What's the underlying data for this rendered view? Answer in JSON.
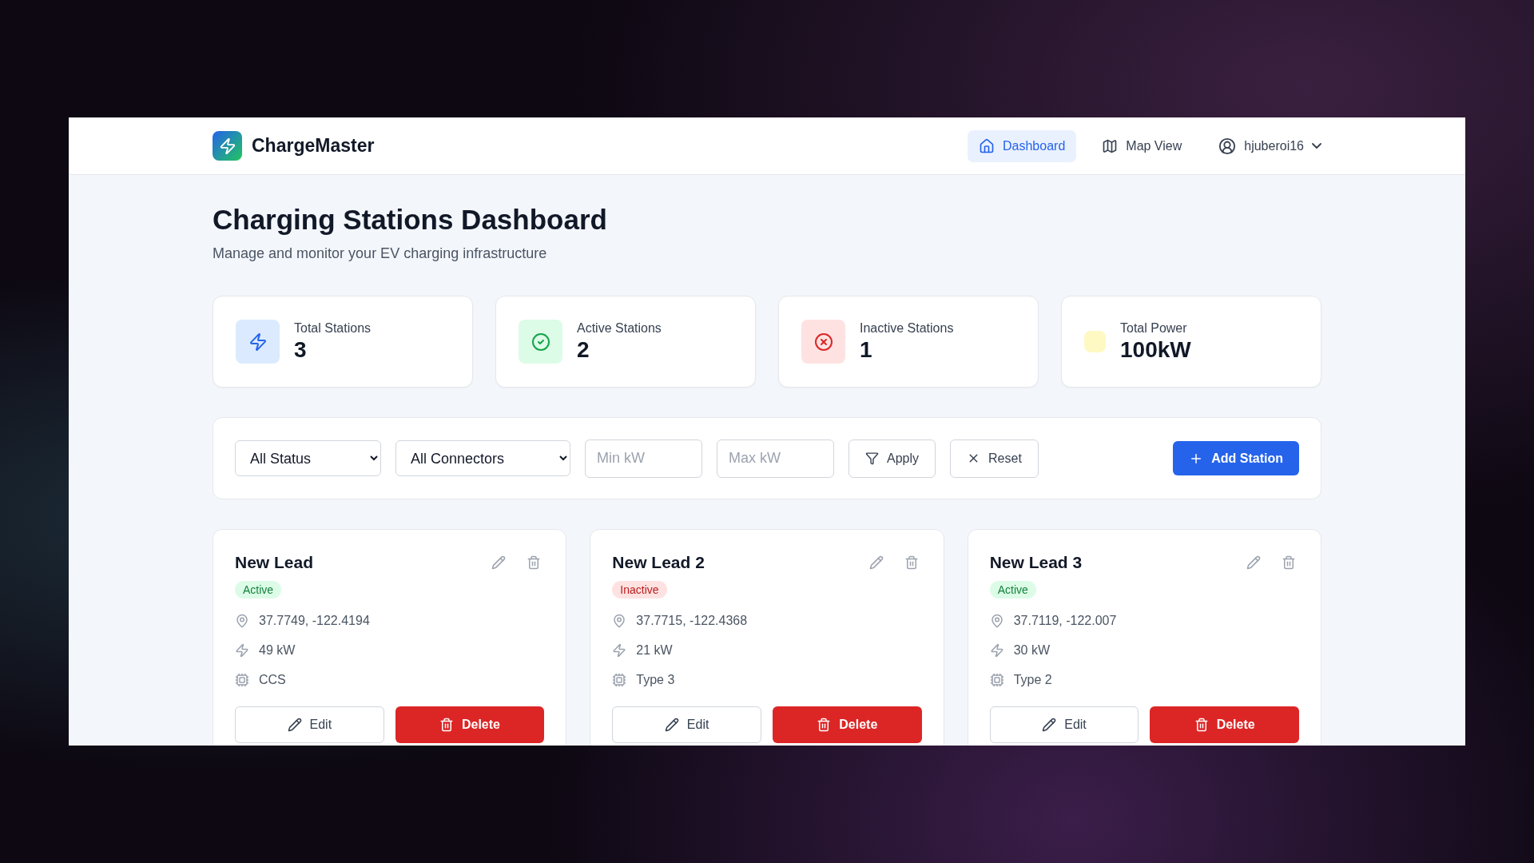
{
  "header": {
    "brand": "ChargeMaster",
    "nav": [
      {
        "label": "Dashboard",
        "kind": "home",
        "selected": true
      },
      {
        "label": "Map View",
        "kind": "map",
        "selected": false
      }
    ],
    "user": "hjuberoi16"
  },
  "page": {
    "title": "Charging Stations Dashboard",
    "subtitle": "Manage and monitor your EV charging infrastructure"
  },
  "stats": [
    {
      "label": "Total Stations",
      "value": "3",
      "kind": "bolt"
    },
    {
      "label": "Active Stations",
      "value": "2",
      "kind": "check"
    },
    {
      "label": "Inactive Stations",
      "value": "1",
      "kind": "cross"
    },
    {
      "label": "Total Power",
      "value": "100kW",
      "kind": "power"
    }
  ],
  "filters": {
    "status": "All Status",
    "connector": "All Connectors",
    "min_placeholder": "Min kW",
    "max_placeholder": "Max kW",
    "apply": "Apply",
    "reset": "Reset",
    "add": "Add Station"
  },
  "stations": [
    {
      "name": "New Lead",
      "kind": "active",
      "status_label": "Active",
      "coords": "37.7749, -122.4194",
      "power": "49 kW",
      "connector": "CCS",
      "edit": "Edit",
      "delete": "Delete"
    },
    {
      "name": "New Lead 2",
      "kind": "inactive",
      "status_label": "Inactive",
      "coords": "37.7715, -122.4368",
      "power": "21 kW",
      "connector": "Type 3",
      "edit": "Edit",
      "delete": "Delete"
    },
    {
      "name": "New Lead 3",
      "kind": "active",
      "status_label": "Active",
      "coords": "37.7119, -122.007",
      "power": "30 kW",
      "connector": "Type 2",
      "edit": "Edit",
      "delete": "Delete"
    }
  ]
}
